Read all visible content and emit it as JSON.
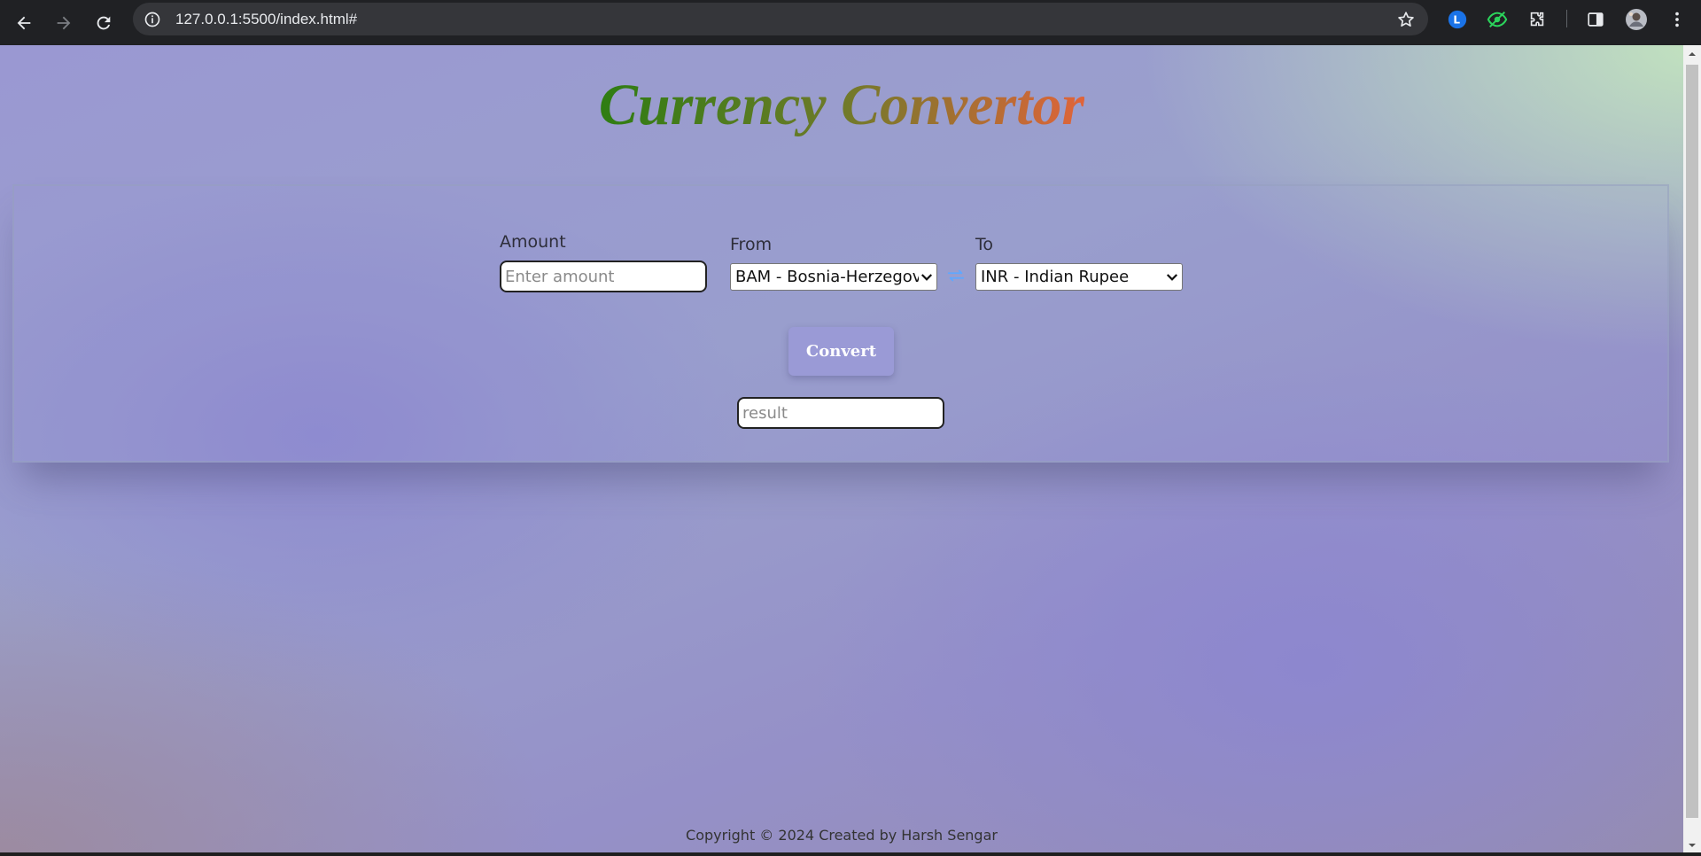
{
  "browser": {
    "url": "127.0.0.1:5500/index.html#",
    "icons": {
      "back": "arrow-left-icon",
      "forward": "arrow-right-icon",
      "reload": "reload-icon",
      "info": "info-icon",
      "bookmark": "star-icon",
      "ext1": "extension-l-icon",
      "ext2": "extension-eye-icon",
      "extensions": "puzzle-icon",
      "sidepanel": "side-panel-icon",
      "profile": "avatar",
      "menu": "kebab-menu-icon"
    },
    "ext1_letter": "L"
  },
  "page": {
    "title": "Currency Convertor",
    "amount_label": "Amount",
    "amount_placeholder": "Enter amount",
    "from_label": "From",
    "from_value": "BAM - Bosnia-Herzegovina Convertible Mark",
    "to_label": "To",
    "to_value": "INR - Indian Rupee",
    "convert_label": "Convert",
    "result_placeholder": "result",
    "footer": "Copyright © 2024 Created by Harsh Sengar"
  },
  "colors": {
    "title_gradient_start": "#2e7d12",
    "title_gradient_end": "#e0643a",
    "button_bg": "#9a9ad6",
    "swap_icon": "#5fa8ff"
  }
}
